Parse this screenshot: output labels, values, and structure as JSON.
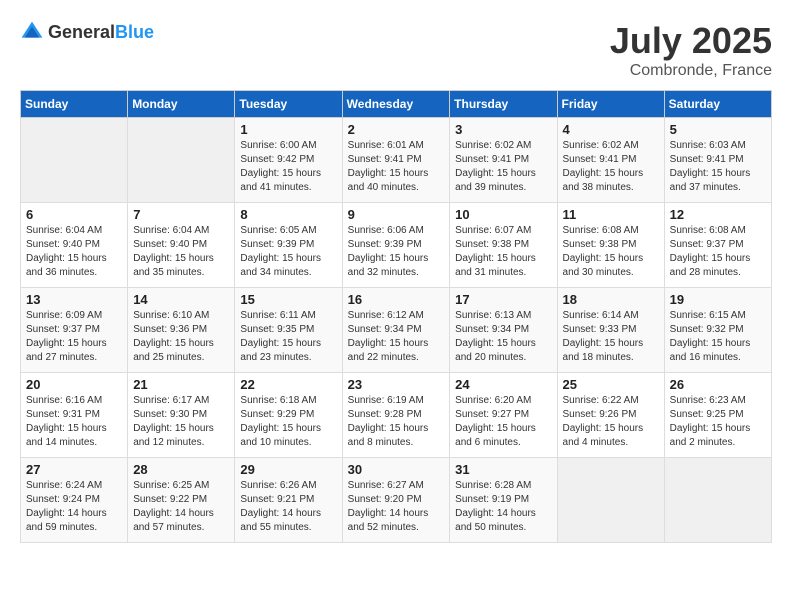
{
  "header": {
    "logo": {
      "general": "General",
      "blue": "Blue"
    },
    "month": "July 2025",
    "location": "Combronde, France"
  },
  "weekdays": [
    "Sunday",
    "Monday",
    "Tuesday",
    "Wednesday",
    "Thursday",
    "Friday",
    "Saturday"
  ],
  "weeks": [
    [
      {
        "day": "",
        "empty": true
      },
      {
        "day": "",
        "empty": true
      },
      {
        "day": "1",
        "sunrise": "6:00 AM",
        "sunset": "9:42 PM",
        "daylight": "15 hours and 41 minutes."
      },
      {
        "day": "2",
        "sunrise": "6:01 AM",
        "sunset": "9:41 PM",
        "daylight": "15 hours and 40 minutes."
      },
      {
        "day": "3",
        "sunrise": "6:02 AM",
        "sunset": "9:41 PM",
        "daylight": "15 hours and 39 minutes."
      },
      {
        "day": "4",
        "sunrise": "6:02 AM",
        "sunset": "9:41 PM",
        "daylight": "15 hours and 38 minutes."
      },
      {
        "day": "5",
        "sunrise": "6:03 AM",
        "sunset": "9:41 PM",
        "daylight": "15 hours and 37 minutes."
      }
    ],
    [
      {
        "day": "6",
        "sunrise": "6:04 AM",
        "sunset": "9:40 PM",
        "daylight": "15 hours and 36 minutes."
      },
      {
        "day": "7",
        "sunrise": "6:04 AM",
        "sunset": "9:40 PM",
        "daylight": "15 hours and 35 minutes."
      },
      {
        "day": "8",
        "sunrise": "6:05 AM",
        "sunset": "9:39 PM",
        "daylight": "15 hours and 34 minutes."
      },
      {
        "day": "9",
        "sunrise": "6:06 AM",
        "sunset": "9:39 PM",
        "daylight": "15 hours and 32 minutes."
      },
      {
        "day": "10",
        "sunrise": "6:07 AM",
        "sunset": "9:38 PM",
        "daylight": "15 hours and 31 minutes."
      },
      {
        "day": "11",
        "sunrise": "6:08 AM",
        "sunset": "9:38 PM",
        "daylight": "15 hours and 30 minutes."
      },
      {
        "day": "12",
        "sunrise": "6:08 AM",
        "sunset": "9:37 PM",
        "daylight": "15 hours and 28 minutes."
      }
    ],
    [
      {
        "day": "13",
        "sunrise": "6:09 AM",
        "sunset": "9:37 PM",
        "daylight": "15 hours and 27 minutes."
      },
      {
        "day": "14",
        "sunrise": "6:10 AM",
        "sunset": "9:36 PM",
        "daylight": "15 hours and 25 minutes."
      },
      {
        "day": "15",
        "sunrise": "6:11 AM",
        "sunset": "9:35 PM",
        "daylight": "15 hours and 23 minutes."
      },
      {
        "day": "16",
        "sunrise": "6:12 AM",
        "sunset": "9:34 PM",
        "daylight": "15 hours and 22 minutes."
      },
      {
        "day": "17",
        "sunrise": "6:13 AM",
        "sunset": "9:34 PM",
        "daylight": "15 hours and 20 minutes."
      },
      {
        "day": "18",
        "sunrise": "6:14 AM",
        "sunset": "9:33 PM",
        "daylight": "15 hours and 18 minutes."
      },
      {
        "day": "19",
        "sunrise": "6:15 AM",
        "sunset": "9:32 PM",
        "daylight": "15 hours and 16 minutes."
      }
    ],
    [
      {
        "day": "20",
        "sunrise": "6:16 AM",
        "sunset": "9:31 PM",
        "daylight": "15 hours and 14 minutes."
      },
      {
        "day": "21",
        "sunrise": "6:17 AM",
        "sunset": "9:30 PM",
        "daylight": "15 hours and 12 minutes."
      },
      {
        "day": "22",
        "sunrise": "6:18 AM",
        "sunset": "9:29 PM",
        "daylight": "15 hours and 10 minutes."
      },
      {
        "day": "23",
        "sunrise": "6:19 AM",
        "sunset": "9:28 PM",
        "daylight": "15 hours and 8 minutes."
      },
      {
        "day": "24",
        "sunrise": "6:20 AM",
        "sunset": "9:27 PM",
        "daylight": "15 hours and 6 minutes."
      },
      {
        "day": "25",
        "sunrise": "6:22 AM",
        "sunset": "9:26 PM",
        "daylight": "15 hours and 4 minutes."
      },
      {
        "day": "26",
        "sunrise": "6:23 AM",
        "sunset": "9:25 PM",
        "daylight": "15 hours and 2 minutes."
      }
    ],
    [
      {
        "day": "27",
        "sunrise": "6:24 AM",
        "sunset": "9:24 PM",
        "daylight": "14 hours and 59 minutes."
      },
      {
        "day": "28",
        "sunrise": "6:25 AM",
        "sunset": "9:22 PM",
        "daylight": "14 hours and 57 minutes."
      },
      {
        "day": "29",
        "sunrise": "6:26 AM",
        "sunset": "9:21 PM",
        "daylight": "14 hours and 55 minutes."
      },
      {
        "day": "30",
        "sunrise": "6:27 AM",
        "sunset": "9:20 PM",
        "daylight": "14 hours and 52 minutes."
      },
      {
        "day": "31",
        "sunrise": "6:28 AM",
        "sunset": "9:19 PM",
        "daylight": "14 hours and 50 minutes."
      },
      {
        "day": "",
        "empty": true
      },
      {
        "day": "",
        "empty": true
      }
    ]
  ]
}
